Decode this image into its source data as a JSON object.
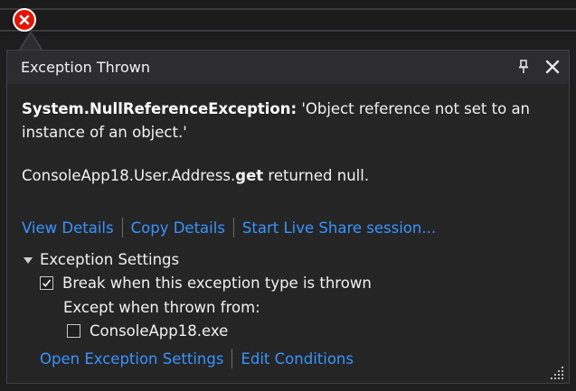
{
  "popup": {
    "title": "Exception Thrown",
    "exception_type": "System.NullReferenceException:",
    "exception_message": " 'Object reference not set to an instance of an object.'",
    "null_source_prefix": "ConsoleApp18.User.Address.",
    "null_source_member": "get",
    "null_source_suffix": " returned null."
  },
  "actions": {
    "view_details": "View Details",
    "copy_details": "Copy Details",
    "live_share": "Start Live Share session..."
  },
  "settings": {
    "header": "Exception Settings",
    "break_label": "Break when this exception type is thrown",
    "break_checked": true,
    "except_label": "Except when thrown from:",
    "module_label": "ConsoleApp18.exe",
    "module_checked": false,
    "open_settings": "Open Exception Settings",
    "edit_conditions": "Edit Conditions"
  },
  "icons": {
    "error": "error-circle-icon",
    "pin": "pin-icon",
    "close": "close-icon",
    "expand": "triangle-down-icon",
    "grip": "resize-grip-icon"
  },
  "colors": {
    "link": "#3794ff",
    "error": "#e51400",
    "background": "#252526"
  }
}
